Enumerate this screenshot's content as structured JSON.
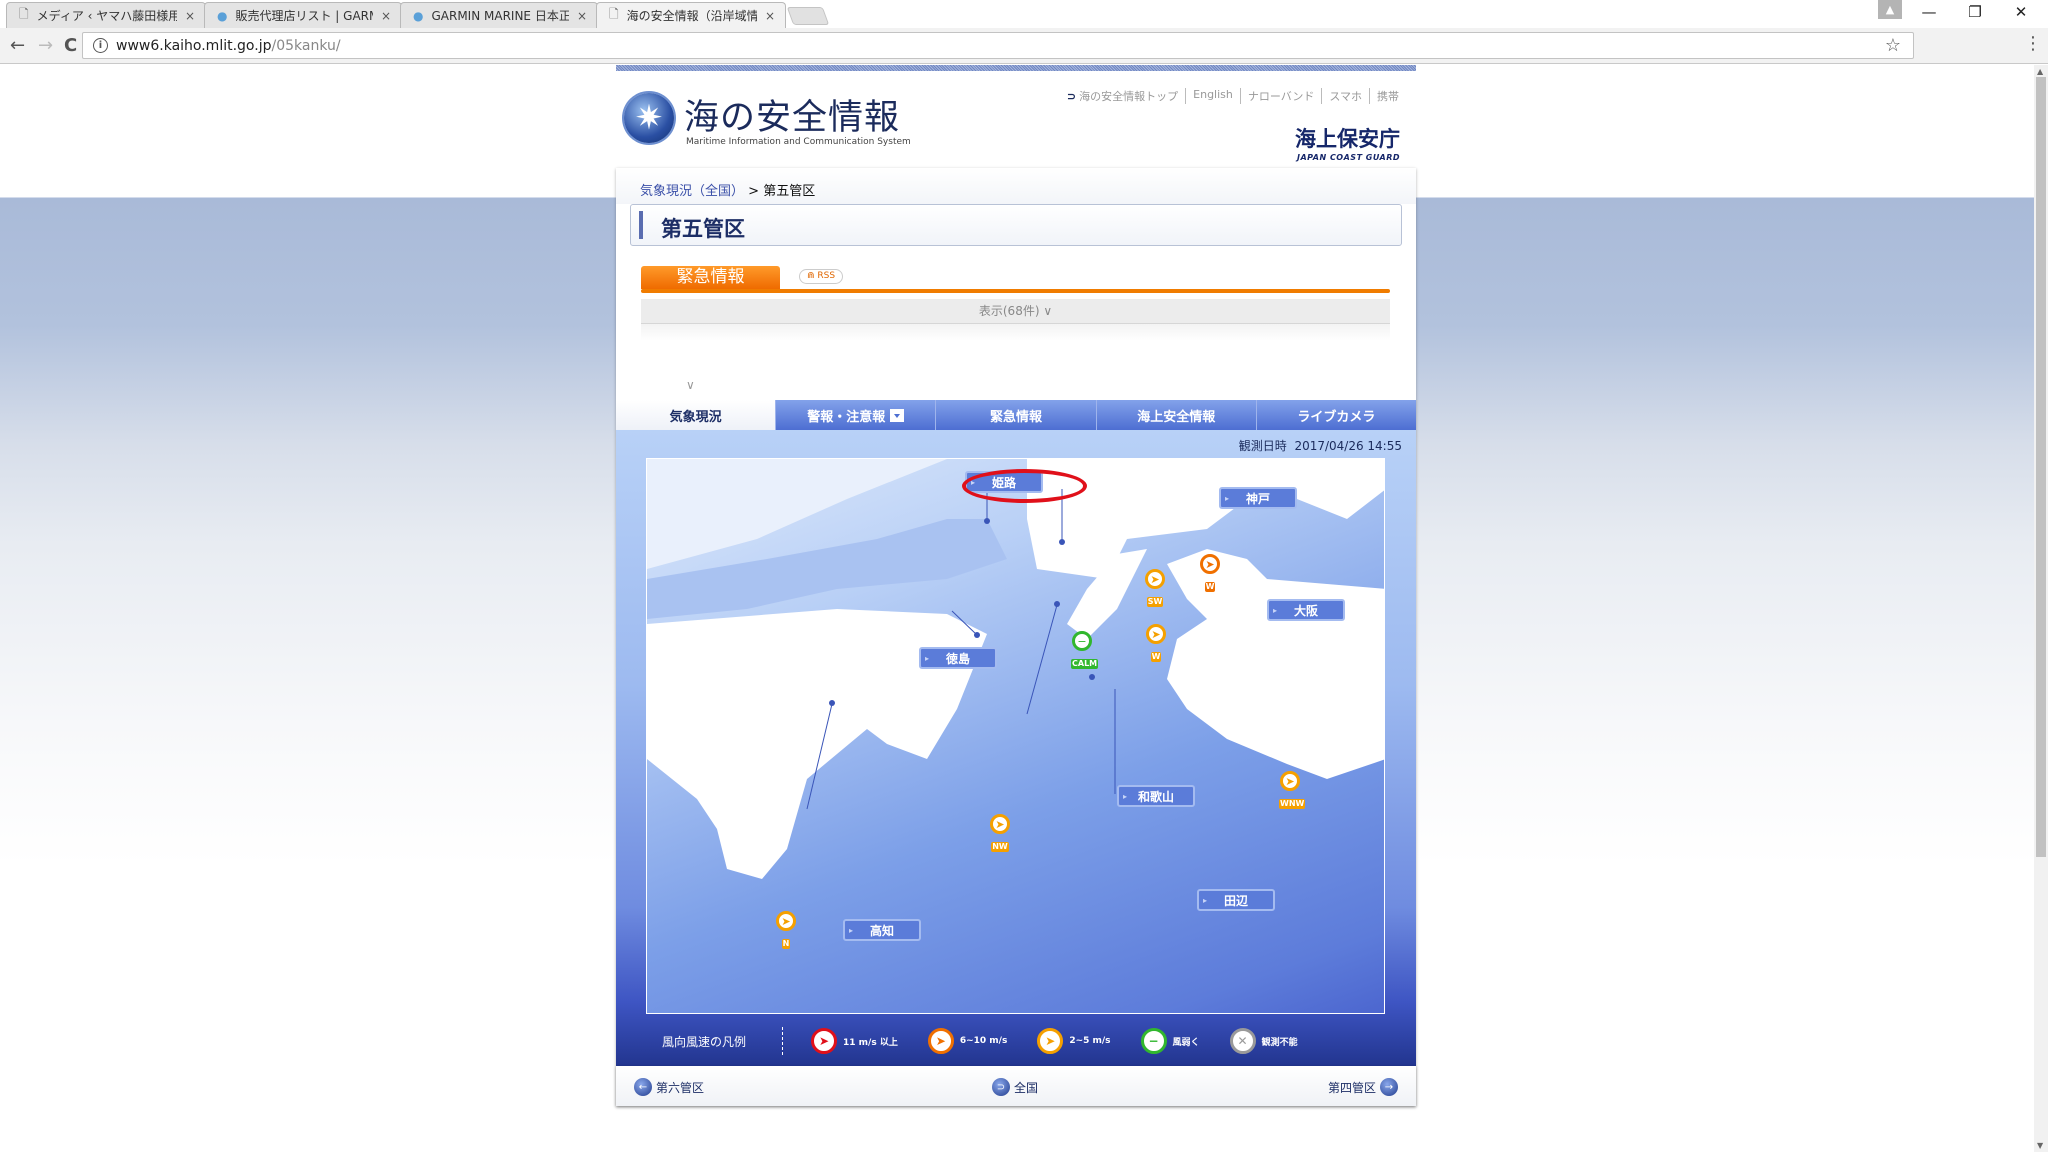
{
  "browser": {
    "tabs": [
      {
        "label": "メディア ‹ ヤマハ藤田様用CM",
        "icon": "page-icon",
        "active": false
      },
      {
        "label": "販売代理店リスト | GARMIN",
        "icon": "globe-icon",
        "active": false
      },
      {
        "label": "GARMIN MARINE 日本正",
        "icon": "globe-icon",
        "active": false
      },
      {
        "label": "海の安全情報（沿岸域情",
        "icon": "page-icon",
        "active": true
      }
    ],
    "url_host": "www6.kaiho.mlit.go.jp",
    "url_path": "/05kanku/",
    "back": "←",
    "forward": "→",
    "reload": "C",
    "star": "☆",
    "menu": "⋮",
    "close_tab": "×",
    "minimize": "—",
    "restore": "❐",
    "close": "✕",
    "user": "👤"
  },
  "header": {
    "site_title": "海の安全情報",
    "site_subtitle": "Maritime Information and Communication System",
    "top_links": [
      "海の安全情報トップ",
      "English",
      "ナローバンド",
      "スマホ",
      "携帯"
    ],
    "agency_ja": "海上保安庁",
    "agency_en": "JAPAN COAST GUARD"
  },
  "breadcrumb": {
    "parent": "気象現況（全国）",
    "separator": ">",
    "current": "第五管区"
  },
  "page_title": "第五管区",
  "emergency": {
    "tab_label": "緊急情報",
    "rss_label": "RSS",
    "show_label": "表示(68件) ∨"
  },
  "main_tabs": [
    {
      "label": "気象現況",
      "active": true
    },
    {
      "label": "警報・注意報",
      "active": false,
      "dropdown": true
    },
    {
      "label": "緊急情報",
      "active": false
    },
    {
      "label": "海上安全情報",
      "active": false
    },
    {
      "label": "ライブカメラ",
      "active": false
    }
  ],
  "observation": {
    "label": "観測日時",
    "datetime": "2017/04/26 14:55"
  },
  "map": {
    "places": [
      {
        "name": "姫路",
        "highlighted": true
      },
      {
        "name": "神戸"
      },
      {
        "name": "大阪"
      },
      {
        "name": "徳島"
      },
      {
        "name": "和歌山"
      },
      {
        "name": "田辺"
      },
      {
        "name": "高知"
      }
    ],
    "wind_markers": [
      {
        "direction": "SW",
        "speed_class": "2~5 m/s"
      },
      {
        "direction": "W",
        "speed_class": "6~10 m/s"
      },
      {
        "direction": "W",
        "speed_class": "2~5 m/s"
      },
      {
        "direction": "CALM",
        "speed_class": "風弱く"
      },
      {
        "direction": "WNW",
        "speed_class": "2~5 m/s"
      },
      {
        "direction": "NW",
        "speed_class": "2~5 m/s"
      },
      {
        "direction": "N",
        "speed_class": "2~5 m/s"
      }
    ]
  },
  "legend": {
    "title": "風向風速の凡例",
    "items": [
      {
        "label": "11 m/s 以上",
        "color": "#e0101a"
      },
      {
        "label": "6~10 m/s",
        "color": "#f07000"
      },
      {
        "label": "2~5 m/s",
        "color": "#f5a000"
      },
      {
        "label": "風弱く",
        "color": "#31b72e"
      },
      {
        "label": "観測不能",
        "color": "#9a9a9a"
      }
    ]
  },
  "bottom_nav": {
    "prev": "第六管区",
    "home": "全国",
    "next": "第四管区"
  },
  "colors": {
    "accent_orange": "#f07c00",
    "tab_blue": "#4d6ed2",
    "navy": "#1d2e66"
  }
}
